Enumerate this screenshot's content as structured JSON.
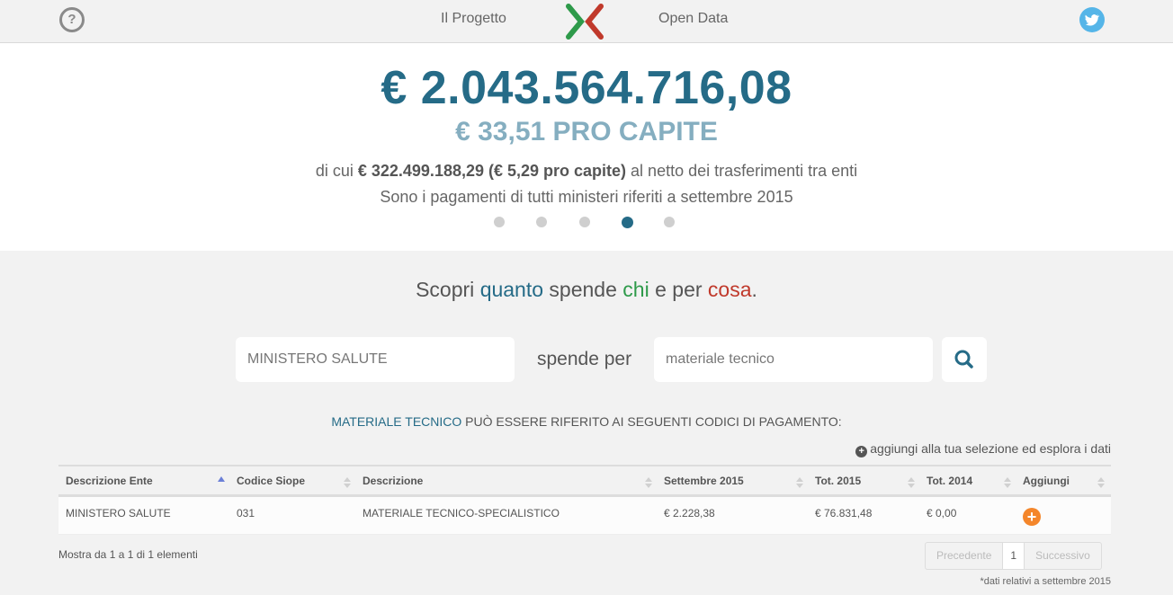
{
  "nav": {
    "progetto_label": "Il Progetto",
    "opendata_label": "Open Data"
  },
  "hero": {
    "total": "€ 2.043.564.716,08",
    "procapite": "€ 33,51 PRO CAPITE",
    "detail_prefix": "di cui ",
    "detail_bold": "€ 322.499.188,29 (€ 5,29 pro capite)",
    "detail_suffix": " al netto dei trasferimenti tra enti",
    "period": "Sono i pagamenti di tutti ministeri riferiti a settembre 2015",
    "active_slide": 4,
    "slide_count": 5
  },
  "tagline": {
    "w1": "Scopri ",
    "w2": "quanto",
    "w3": " spende ",
    "w4": "chi",
    "w5": " e per ",
    "w6": "cosa",
    "w7": "."
  },
  "search": {
    "ente_value": "MINISTERO SALUTE",
    "connector": "spende per",
    "cosa_value": "materiale tecnico"
  },
  "results": {
    "term": "MATERIALE TECNICO",
    "heading_rest": " PUÒ ESSERE RIFERITO AI SEGUENTI CODICI DI PAGAMENTO:",
    "add_hint": "aggiungi alla tua selezione ed esplora i dati"
  },
  "table": {
    "headers": [
      "Descrizione Ente",
      "Codice Siope",
      "Descrizione",
      "Settembre 2015",
      "Tot. 2015",
      "Tot. 2014",
      "Aggiungi"
    ],
    "rows": [
      [
        "MINISTERO SALUTE",
        "031",
        "MATERIALE TECNICO-SPECIALISTICO",
        "€ 2.228,38",
        "€ 76.831,48",
        "€ 0,00"
      ]
    ]
  },
  "footer": {
    "info": "Mostra da 1 a 1 di 1 elementi",
    "prev": "Precedente",
    "page": "1",
    "next": "Successivo",
    "footnote": "*dati relativi a settembre 2015"
  },
  "colors": {
    "accent_blue": "#256b87",
    "green": "#2e9a4a",
    "red": "#c0392b",
    "orange": "#f4862b",
    "twitter": "#55b5e8"
  }
}
